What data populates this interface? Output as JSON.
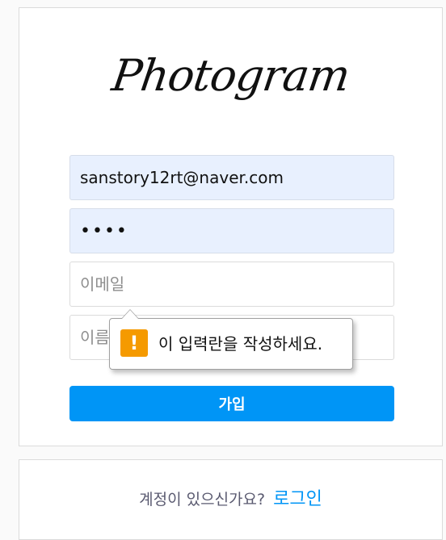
{
  "brand": {
    "logo_text": "Photogram"
  },
  "signup_form": {
    "email_prefilled_value": "sanstory12rt@naver.com",
    "password_value": "1234",
    "email_placeholder": "이메일",
    "name_placeholder": "이름",
    "submit_label": "가입"
  },
  "validation_tooltip": {
    "icon": "warning-icon",
    "icon_glyph": "!",
    "message": "이 입력란을 작성하세요.",
    "color": "#f59a00"
  },
  "login_prompt": {
    "text": "계정이 있으신가요?",
    "link_label": "로그인"
  },
  "colors": {
    "accent": "#0095f6",
    "autofill_bg": "#e8f0fe"
  }
}
